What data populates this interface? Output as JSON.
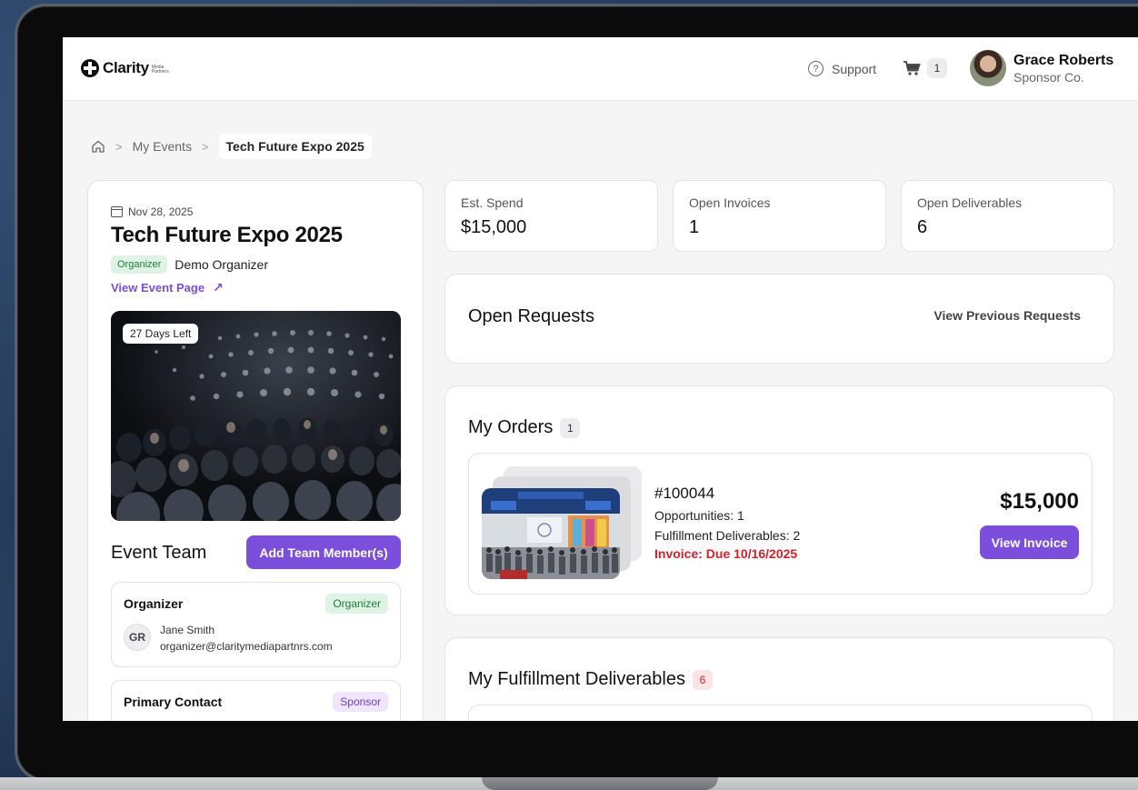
{
  "header": {
    "brand": "Clarity",
    "brand_sub": "Media Partners",
    "support_label": "Support",
    "cart_count": "1",
    "user_name": "Grace Roberts",
    "user_org": "Sponsor Co."
  },
  "breadcrumb": {
    "items": [
      "My Events"
    ],
    "current": "Tech Future Expo 2025"
  },
  "event": {
    "date": "Nov 28, 2025",
    "title": "Tech Future Expo 2025",
    "organizer_badge": "Organizer",
    "organizer_name": "Demo Organizer",
    "view_event_label": "View Event Page",
    "days_left": "27 Days Left"
  },
  "team": {
    "title": "Event Team",
    "add_button": "Add Team Member(s)",
    "contacts": [
      {
        "role": "Organizer",
        "badge": "Organizer",
        "initials": "GR",
        "name": "Jane Smith",
        "email": "organizer@claritymediapartnrs.com"
      },
      {
        "role": "Primary Contact",
        "badge": "Sponsor"
      }
    ]
  },
  "stats": [
    {
      "label": "Est. Spend",
      "value": "$15,000"
    },
    {
      "label": "Open Invoices",
      "value": "1"
    },
    {
      "label": "Open Deliverables",
      "value": "6"
    }
  ],
  "open_requests": {
    "title": "Open Requests",
    "view_previous": "View Previous Requests"
  },
  "orders": {
    "title": "My Orders",
    "count": "1",
    "items": [
      {
        "id": "#100044",
        "opportunities": "Opportunities: 1",
        "deliverables": "Fulfillment Deliverables: 2",
        "invoice": "Invoice: Due 10/16/2025",
        "total": "$15,000",
        "view_invoice": "View Invoice"
      }
    ]
  },
  "fulfillment": {
    "title": "My Fulfillment Deliverables",
    "count": "6"
  },
  "colors": {
    "accent": "#7b4fdb",
    "danger": "#d0202a",
    "success_bg": "#dff3e5",
    "success_text": "#1f7a3d"
  }
}
